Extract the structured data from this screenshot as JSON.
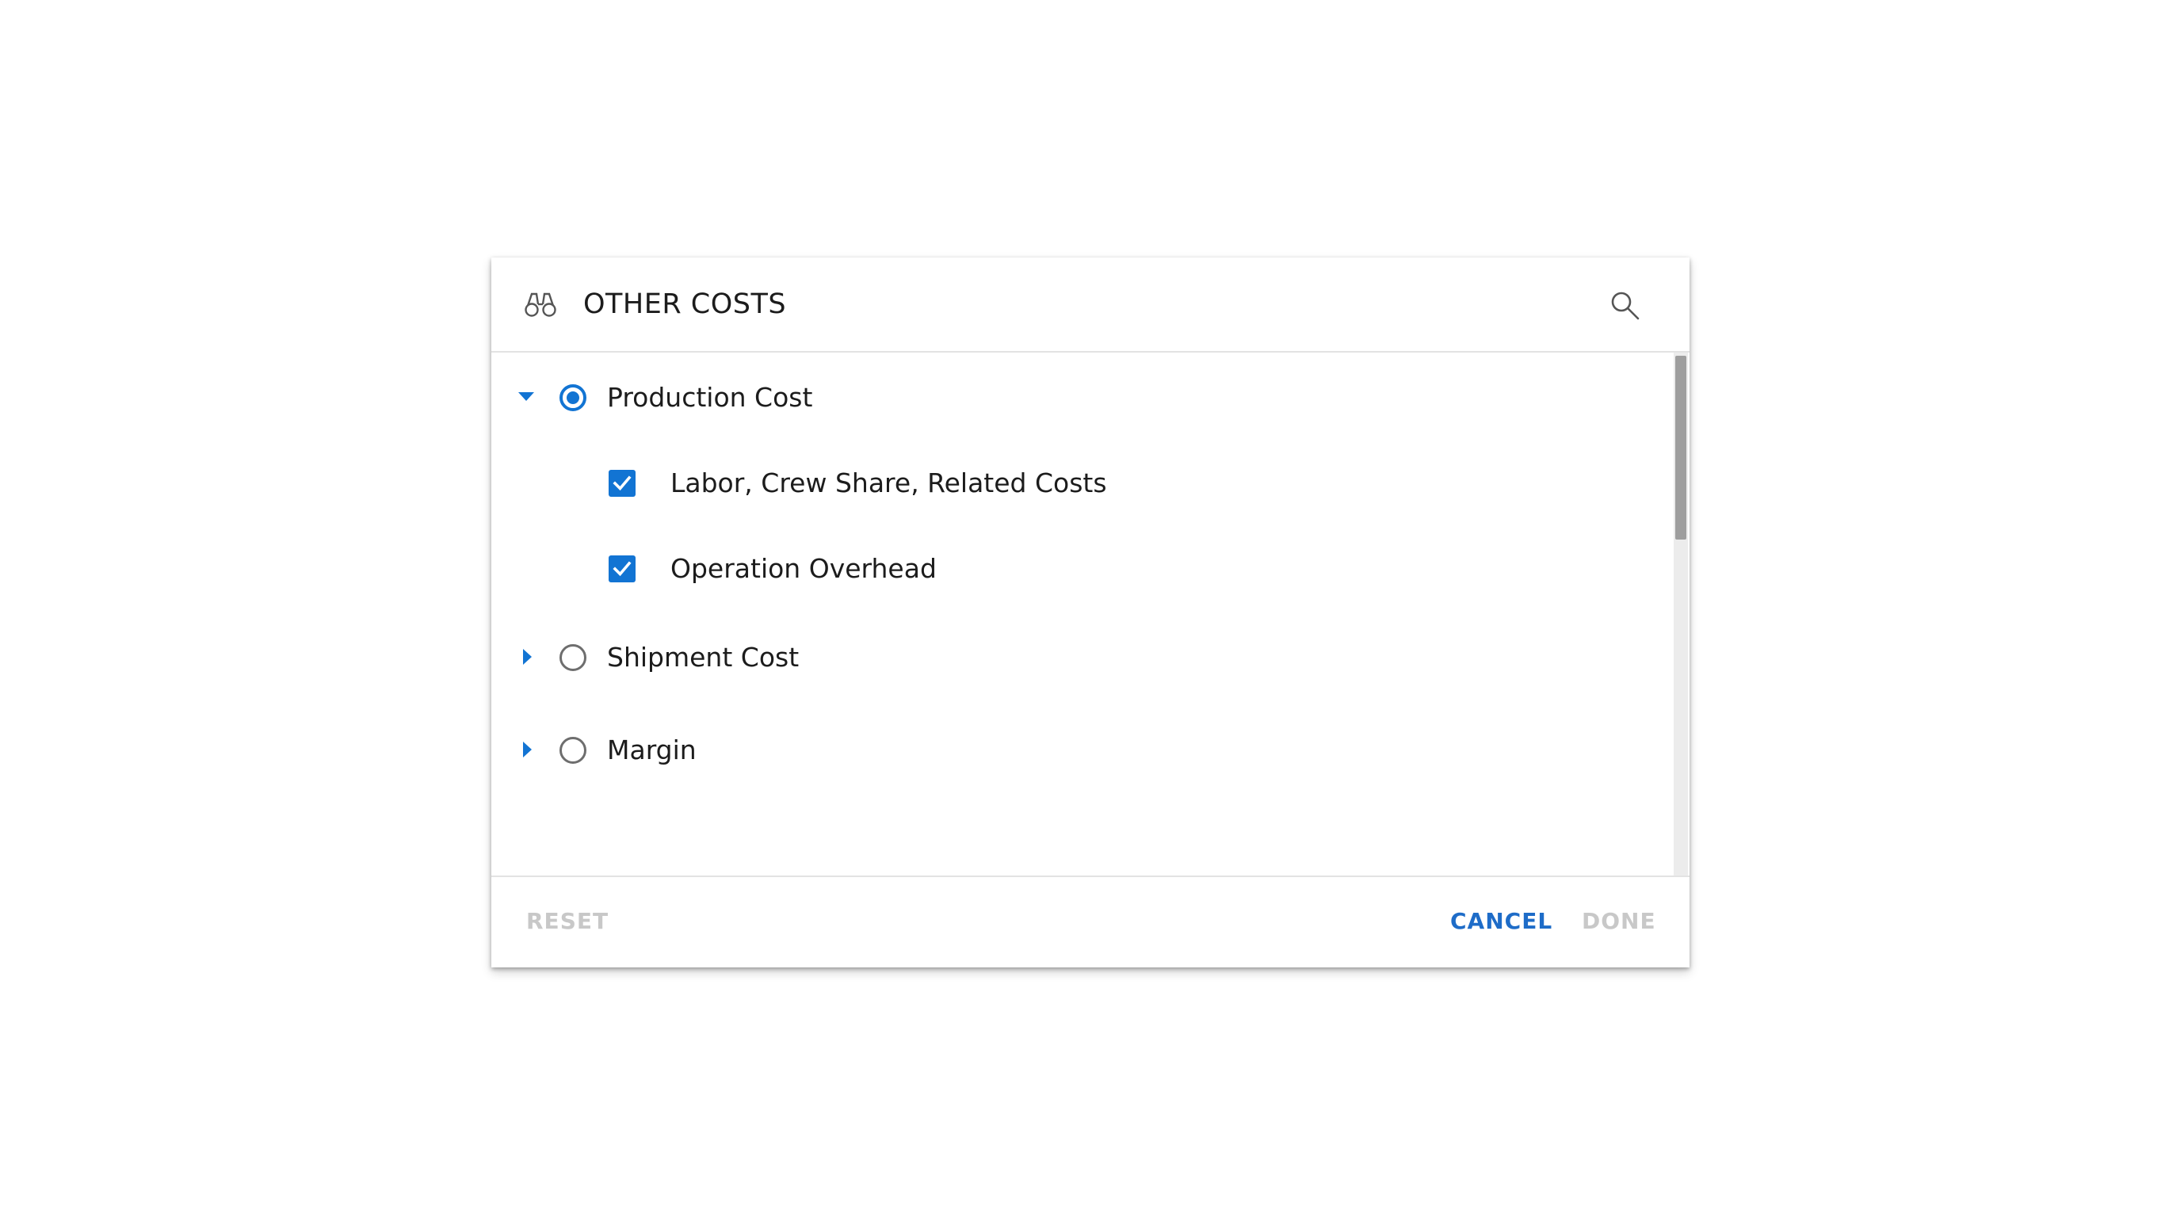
{
  "dialog": {
    "title": "OTHER COSTS",
    "title_icon": "binoculars-icon",
    "search_icon": "search-icon"
  },
  "tree": {
    "items": [
      {
        "label": "Production Cost",
        "expanded": true,
        "selected": true,
        "children": [
          {
            "label": "Labor, Crew Share, Related Costs",
            "checked": true
          },
          {
            "label": "Operation Overhead",
            "checked": true
          }
        ]
      },
      {
        "label": "Shipment Cost",
        "expanded": false,
        "selected": false
      },
      {
        "label": "Margin",
        "expanded": false,
        "selected": false
      }
    ]
  },
  "footer": {
    "reset_label": "RESET",
    "cancel_label": "CANCEL",
    "done_label": "DONE"
  },
  "colors": {
    "accent": "#1274d3",
    "disabled_text": "#c8c8c8",
    "text": "#1c1c1c"
  }
}
